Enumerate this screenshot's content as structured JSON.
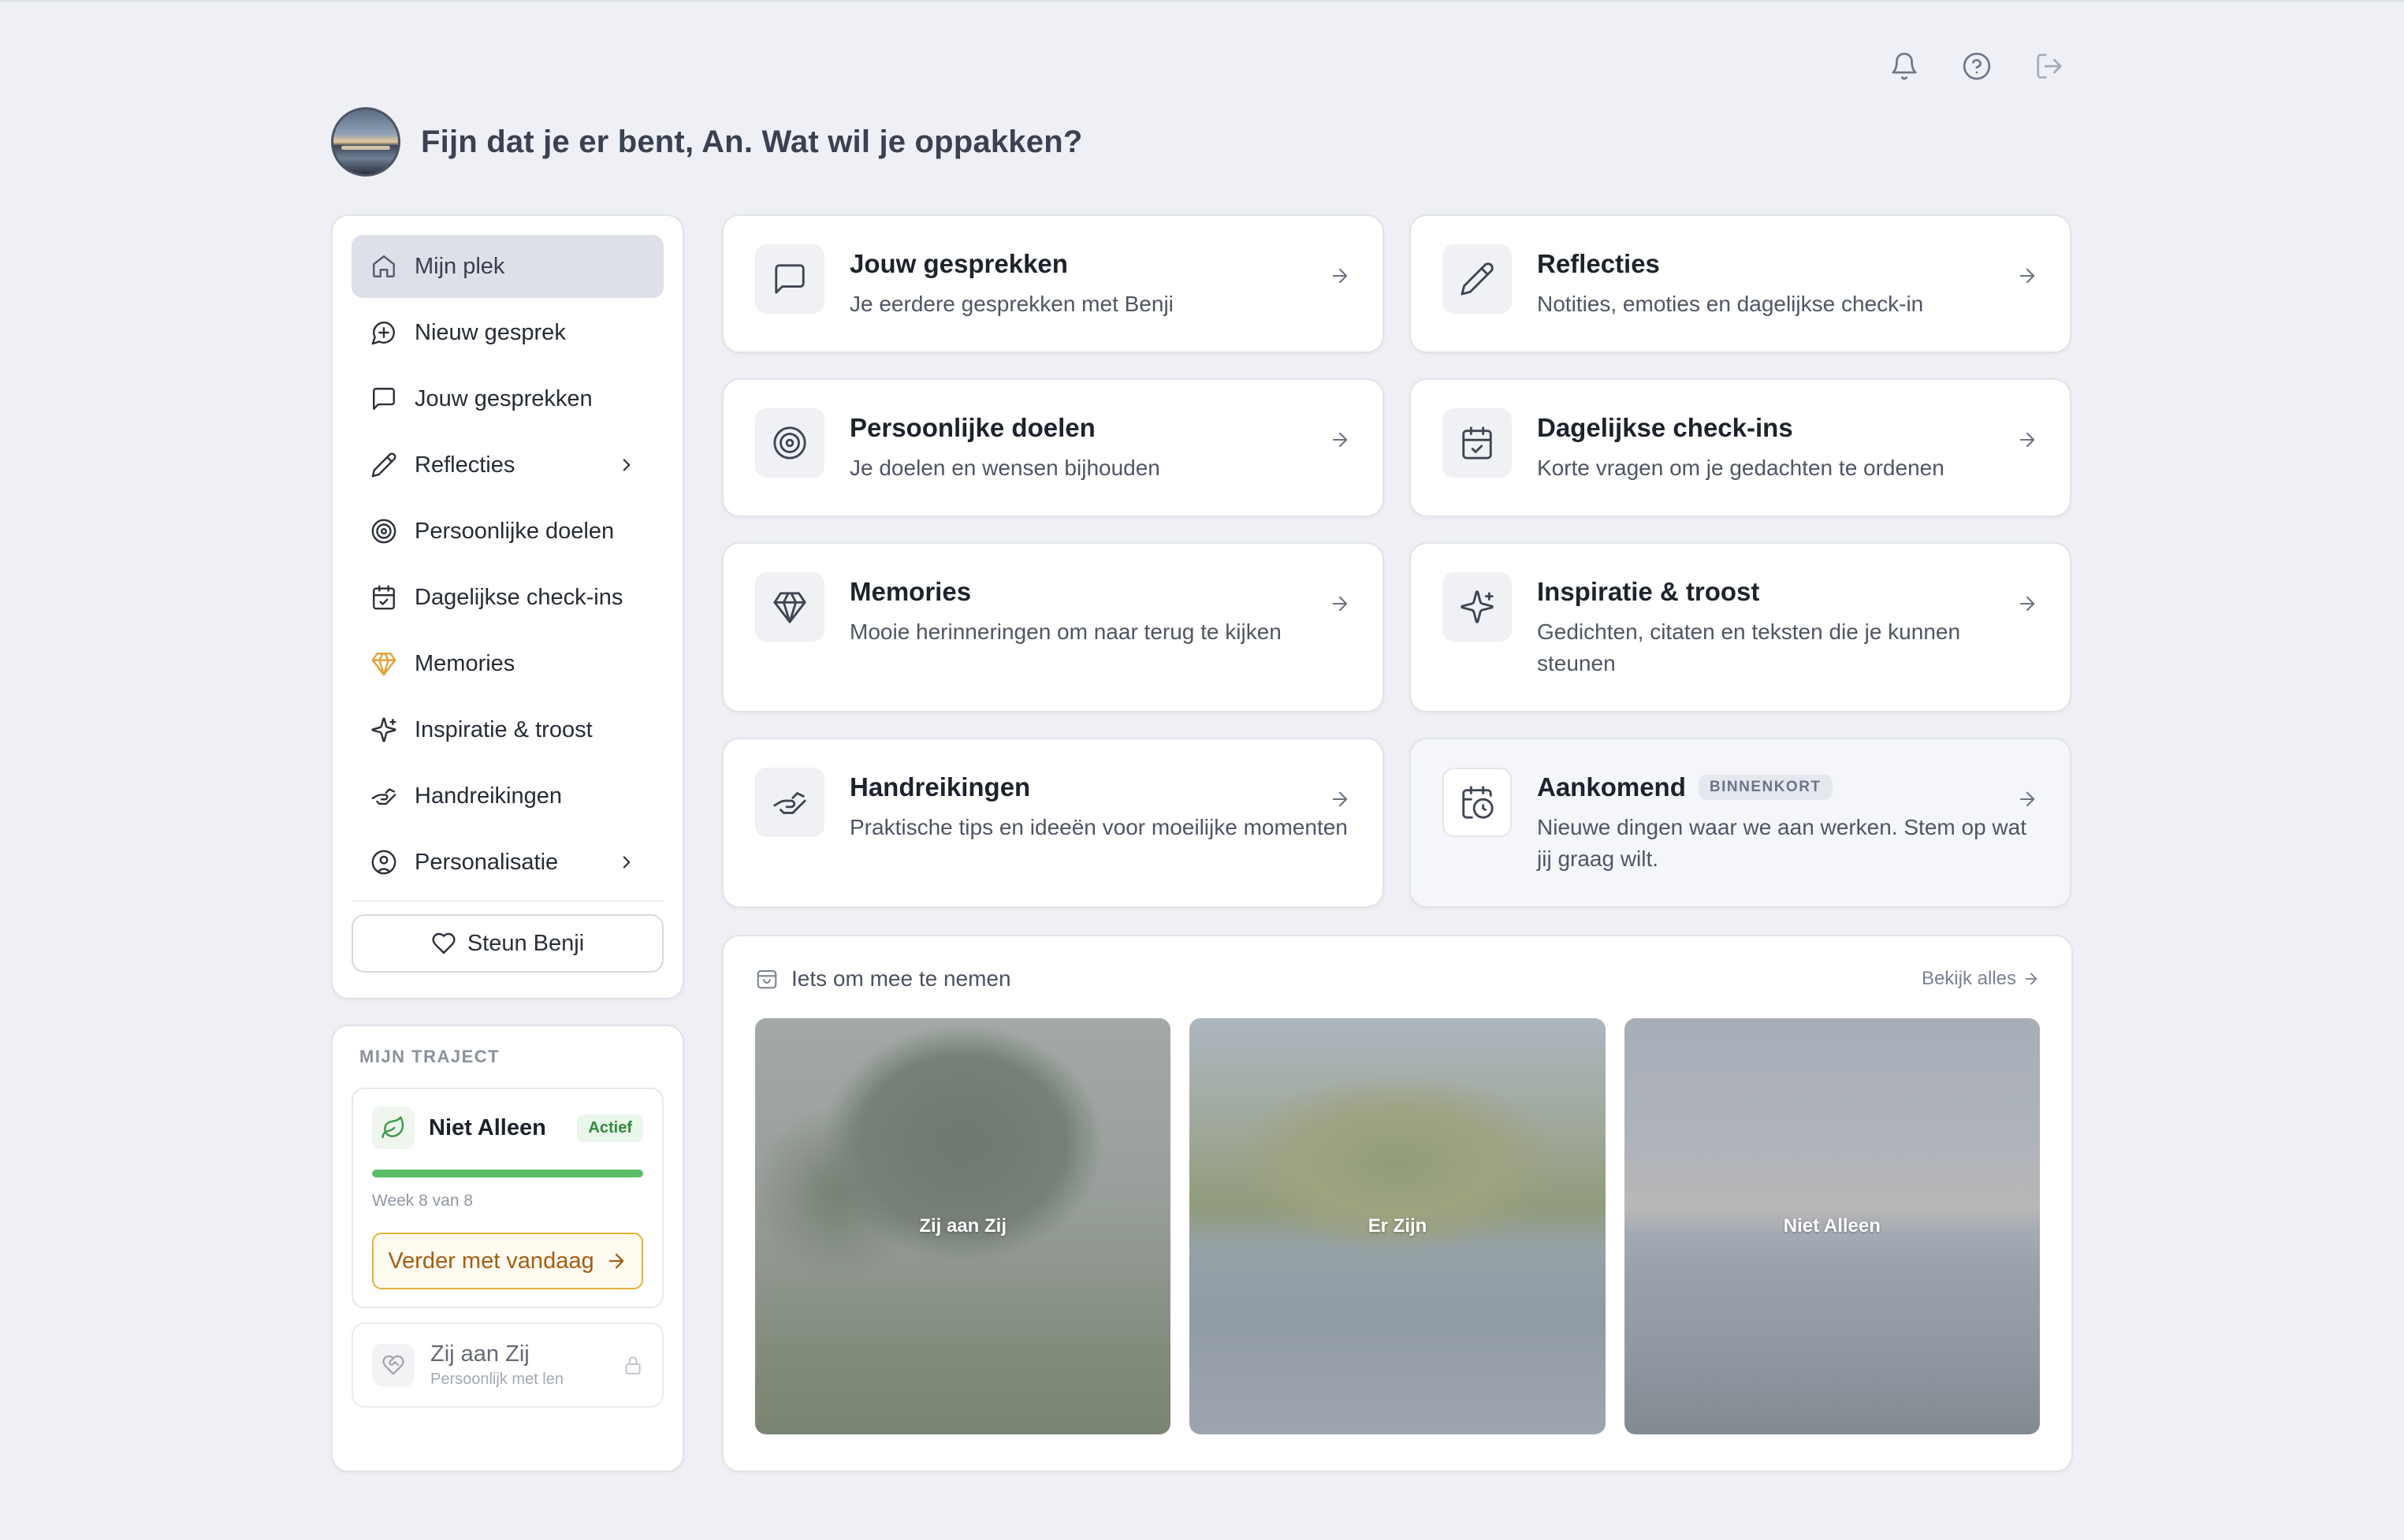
{
  "header": {
    "greeting": "Fijn dat je er bent, An. Wat wil je oppakken?"
  },
  "top_icons": [
    "bell-icon",
    "help-circle-icon",
    "logout-icon"
  ],
  "sidebar": {
    "items": [
      {
        "label": "Mijn plek",
        "icon": "home-icon",
        "active": true
      },
      {
        "label": "Nieuw gesprek",
        "icon": "chat-plus-icon"
      },
      {
        "label": "Jouw gesprekken",
        "icon": "chat-icon"
      },
      {
        "label": "Reflecties",
        "icon": "pencil-icon",
        "chevron": true
      },
      {
        "label": "Persoonlijke doelen",
        "icon": "target-icon"
      },
      {
        "label": "Dagelijkse check-ins",
        "icon": "calendar-check-icon"
      },
      {
        "label": "Memories",
        "icon": "gem-icon"
      },
      {
        "label": "Inspiratie & troost",
        "icon": "sparkles-icon"
      },
      {
        "label": "Handreikingen",
        "icon": "handshake-icon"
      },
      {
        "label": "Personalisatie",
        "icon": "user-circle-icon",
        "chevron": true
      }
    ],
    "support_label": "Steun Benji"
  },
  "traject": {
    "label": "MIJN TRAJECT",
    "active_course": {
      "title": "Niet Alleen",
      "badge": "Actief",
      "progress": 1.0,
      "week_text": "Week 8 van 8",
      "button": "Verder met vandaag"
    },
    "locked_course": {
      "title": "Zij aan Zij",
      "subtitle": "Persoonlijk met len"
    }
  },
  "cards": [
    {
      "title": "Jouw gesprekken",
      "sub": "Je eerdere gesprekken met Benji",
      "icon": "chat-icon"
    },
    {
      "title": "Reflecties",
      "sub": "Notities, emoties en dagelijkse check-in",
      "icon": "pencil-icon"
    },
    {
      "title": "Persoonlijke doelen",
      "sub": "Je doelen en wensen bijhouden",
      "icon": "target-icon"
    },
    {
      "title": "Dagelijkse check-ins",
      "sub": "Korte vragen om je gedachten te ordenen",
      "icon": "calendar-check-icon"
    },
    {
      "title": "Memories",
      "sub": "Mooie herinneringen om naar terug te kijken",
      "icon": "gem-icon"
    },
    {
      "title": "Inspiratie & troost",
      "sub": "Gedichten, citaten en teksten die je kunnen steunen",
      "icon": "sparkles-icon"
    },
    {
      "title": "Handreikingen",
      "sub": "Praktische tips en ideeën voor moeilijke momenten",
      "icon": "handshake-icon"
    },
    {
      "title": "Aankomend",
      "badge": "BINNENKORT",
      "sub": "Nieuwe dingen waar we aan werken. Stem op wat jij graag wilt.",
      "icon": "calendar-clock-icon"
    }
  ],
  "take_along": {
    "title": "Iets om mee te nemen",
    "see_all": "Bekijk alles",
    "tiles": [
      "Zij aan Zij",
      "Er Zijn",
      "Niet Alleen"
    ]
  }
}
